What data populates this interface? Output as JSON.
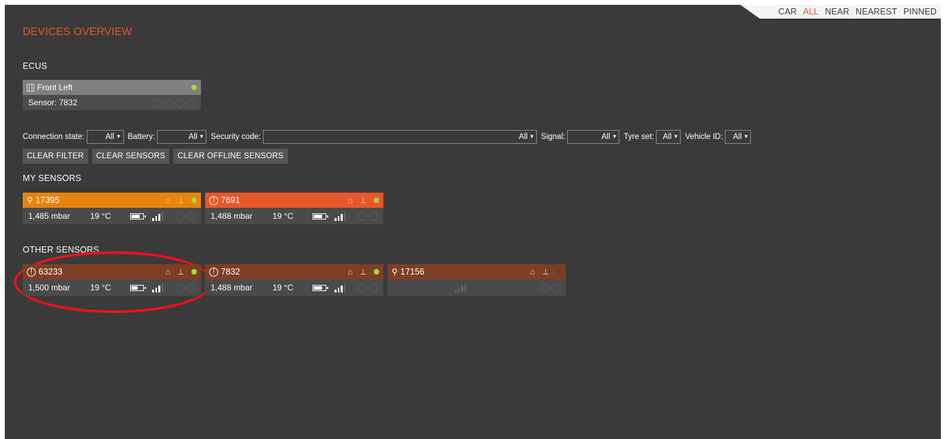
{
  "nav": {
    "items": [
      "CAR",
      "ALL",
      "NEAR",
      "NEAREST",
      "PINNED"
    ],
    "active": "ALL"
  },
  "page_title": "DEVICES OVERVIEW",
  "ecus": {
    "label": "ECUS",
    "card": {
      "name": "Front Left",
      "sensor_label": "Sensor: 7832",
      "status_color": "#a6d93a"
    }
  },
  "filters": {
    "connection_state": {
      "label": "Connection state:",
      "value": "All"
    },
    "battery": {
      "label": "Battery:",
      "value": "All"
    },
    "security_code": {
      "label": "Security code:",
      "value": "All"
    },
    "signal": {
      "label": "Signal:",
      "value": "All"
    },
    "tyre_set": {
      "label": "Tyre set:",
      "value": "All"
    },
    "vehicle_id": {
      "label": "Vehicle ID:",
      "value": "All"
    }
  },
  "buttons": {
    "clear_filter": "CLEAR FILTER",
    "clear_sensors": "CLEAR SENSORS",
    "clear_offline": "CLEAR OFFLINE SENSORS"
  },
  "my_sensors": {
    "label": "MY SENSORS",
    "cards": [
      {
        "id": "17395",
        "icon": "tyre-icon",
        "header_color": "#e8830c",
        "pressure": "1,485 mbar",
        "temperature": "19 °C",
        "battery_level": 0.8,
        "signal_bars": 3,
        "status": "online"
      },
      {
        "id": "7691",
        "icon": "warn-icon",
        "header_color": "#e8572b",
        "pressure": "1,488 mbar",
        "temperature": "19 °C",
        "battery_level": 0.8,
        "signal_bars": 3,
        "status": "online"
      }
    ]
  },
  "other_sensors": {
    "label": "OTHER SENSORS",
    "cards": [
      {
        "id": "63233",
        "icon": "warn-icon",
        "header_color": "#7e3e24",
        "pressure": "1,500 mbar",
        "temperature": "19 °C",
        "battery_level": 0.6,
        "signal_bars": 3,
        "status": "online"
      },
      {
        "id": "7832",
        "icon": "warn-icon",
        "header_color": "#7e3e24",
        "pressure": "1,488 mbar",
        "temperature": "19 °C",
        "battery_level": 0.8,
        "signal_bars": 3,
        "status": "online"
      },
      {
        "id": "17156",
        "icon": "tyre-icon",
        "header_color": "#7e3e24",
        "pressure": "",
        "temperature": "",
        "battery_level": 0,
        "signal_bars": 0,
        "status": "offline"
      }
    ]
  },
  "colors": {
    "accent": "#e8572b",
    "online": "#a6d93a",
    "annotation": "#e5141c"
  }
}
